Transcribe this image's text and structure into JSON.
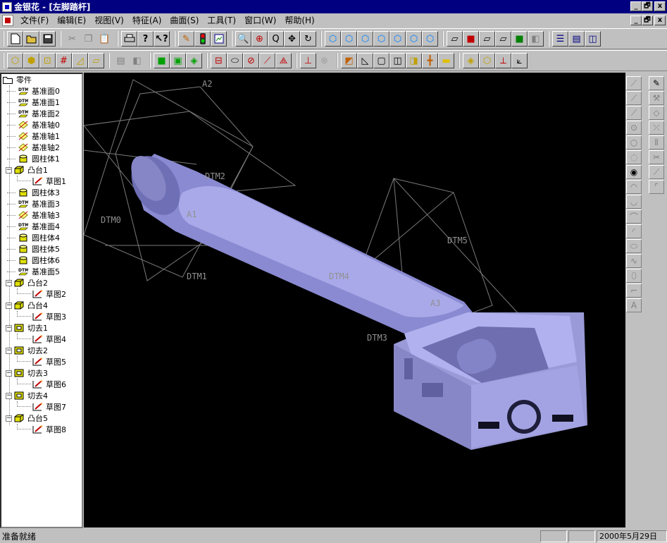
{
  "window": {
    "title": "金银花 - [左脚踏杆]",
    "caption_buttons": [
      "_",
      "🗗",
      "x"
    ],
    "mdi_buttons": [
      "_",
      "🗗",
      "x"
    ]
  },
  "menu": [
    "文件(F)",
    "编辑(E)",
    "视图(V)",
    "特征(A)",
    "曲面(S)",
    "工具(T)",
    "窗口(W)",
    "帮助(H)"
  ],
  "toolbar1": {
    "groups": [
      [
        "new-file",
        "open-file",
        "save"
      ],
      [
        "cut",
        "copy",
        "paste"
      ],
      [
        "print",
        "help",
        "context-help"
      ],
      [
        "eraser",
        "traffic-light",
        "model-view"
      ],
      [
        "zoom",
        "zoom-in",
        "zoom-window",
        "pan",
        "rotate"
      ],
      [
        "view-iso",
        "view-front",
        "view-back",
        "view-left",
        "view-right",
        "view-top",
        "view-bottom"
      ],
      [
        "wireframe",
        "shaded",
        "hidden-line",
        "no-hidden",
        "color-shade",
        "texture"
      ],
      [
        "tile-horizontal",
        "tile-hlines",
        "tile-vertical"
      ]
    ]
  },
  "toolbar2": {
    "groups": [
      [
        "box",
        "cylinder",
        "cone-block",
        "grid",
        "wedge",
        "prism"
      ],
      [
        "stack",
        "layer"
      ],
      [
        "shell-green",
        "frame",
        "extrude"
      ],
      [
        "datum-plane",
        "datum-axis",
        "datum-plane-cross",
        "datum-line",
        "datum-point"
      ],
      [
        "coord-system",
        "disabled-circle"
      ],
      [
        "fillet",
        "chamfer",
        "draft",
        "round",
        "mirror",
        "line-tool",
        "face"
      ],
      [
        "pattern",
        "copy-feature",
        "trim",
        "sweep"
      ]
    ]
  },
  "model_tree": [
    {
      "label": "零件",
      "icon": "folder",
      "level": 0
    },
    {
      "label": "基准面0",
      "icon": "datum-plane",
      "level": 1
    },
    {
      "label": "基准面1",
      "icon": "datum-plane",
      "level": 1
    },
    {
      "label": "基准面2",
      "icon": "datum-plane",
      "level": 1
    },
    {
      "label": "基准轴0",
      "icon": "datum-axis",
      "level": 1
    },
    {
      "label": "基准轴1",
      "icon": "datum-axis",
      "level": 1
    },
    {
      "label": "基准轴2",
      "icon": "datum-axis",
      "level": 1
    },
    {
      "label": "圆柱体1",
      "icon": "cylinder",
      "level": 1
    },
    {
      "label": "凸台1",
      "icon": "boss",
      "level": 1,
      "expanded": true
    },
    {
      "label": "草图1",
      "icon": "sketch",
      "level": 2
    },
    {
      "label": "圆柱体3",
      "icon": "cylinder",
      "level": 1
    },
    {
      "label": "基准面3",
      "icon": "datum-plane",
      "level": 1
    },
    {
      "label": "基准轴3",
      "icon": "datum-axis",
      "level": 1
    },
    {
      "label": "基准面4",
      "icon": "datum-plane",
      "level": 1
    },
    {
      "label": "圆柱体4",
      "icon": "cylinder",
      "level": 1
    },
    {
      "label": "圆柱体5",
      "icon": "cylinder",
      "level": 1
    },
    {
      "label": "圆柱体6",
      "icon": "cylinder",
      "level": 1
    },
    {
      "label": "基准面5",
      "icon": "datum-plane",
      "level": 1
    },
    {
      "label": "凸台2",
      "icon": "boss",
      "level": 1,
      "expanded": true
    },
    {
      "label": "草图2",
      "icon": "sketch",
      "level": 2
    },
    {
      "label": "凸台4",
      "icon": "boss",
      "level": 1,
      "expanded": true
    },
    {
      "label": "草图3",
      "icon": "sketch",
      "level": 2
    },
    {
      "label": "切去1",
      "icon": "cut",
      "level": 1,
      "expanded": true
    },
    {
      "label": "草图4",
      "icon": "sketch",
      "level": 2
    },
    {
      "label": "切去2",
      "icon": "cut",
      "level": 1,
      "expanded": true
    },
    {
      "label": "草图5",
      "icon": "sketch",
      "level": 2
    },
    {
      "label": "切去3",
      "icon": "cut",
      "level": 1,
      "expanded": true
    },
    {
      "label": "草图6",
      "icon": "sketch",
      "level": 2
    },
    {
      "label": "切去4",
      "icon": "cut",
      "level": 1,
      "expanded": true
    },
    {
      "label": "草图7",
      "icon": "sketch",
      "level": 2
    },
    {
      "label": "凸台5",
      "icon": "boss",
      "level": 1,
      "expanded": true
    },
    {
      "label": "草图8",
      "icon": "sketch",
      "level": 2
    }
  ],
  "viewport": {
    "background": "#000000",
    "model_color": "#a7a7e6",
    "datum_labels": [
      "A2",
      "DTM2",
      "DTM0",
      "A1",
      "DTM1",
      "DTM4",
      "DTM5",
      "A3",
      "DTM3"
    ]
  },
  "sketch_palette": [
    "line",
    "polyline",
    "arc-line",
    "circle-center",
    "circle-3pt",
    "circle-tan",
    "circle-solid",
    "arc-3pt",
    "arc-center",
    "arc-tan",
    "arc-end",
    "ellipse",
    "spline",
    "ellipse-arc",
    "corner",
    "text"
  ],
  "edit_palette": [
    "pencil",
    "wrench",
    "eraser-tool",
    "close-tool",
    "mirror-tool",
    "scissors",
    "extend",
    "fillet-tool"
  ],
  "status": {
    "message": "准备就绪",
    "pane1": "",
    "pane2": "",
    "date": "2000年5月29日"
  }
}
